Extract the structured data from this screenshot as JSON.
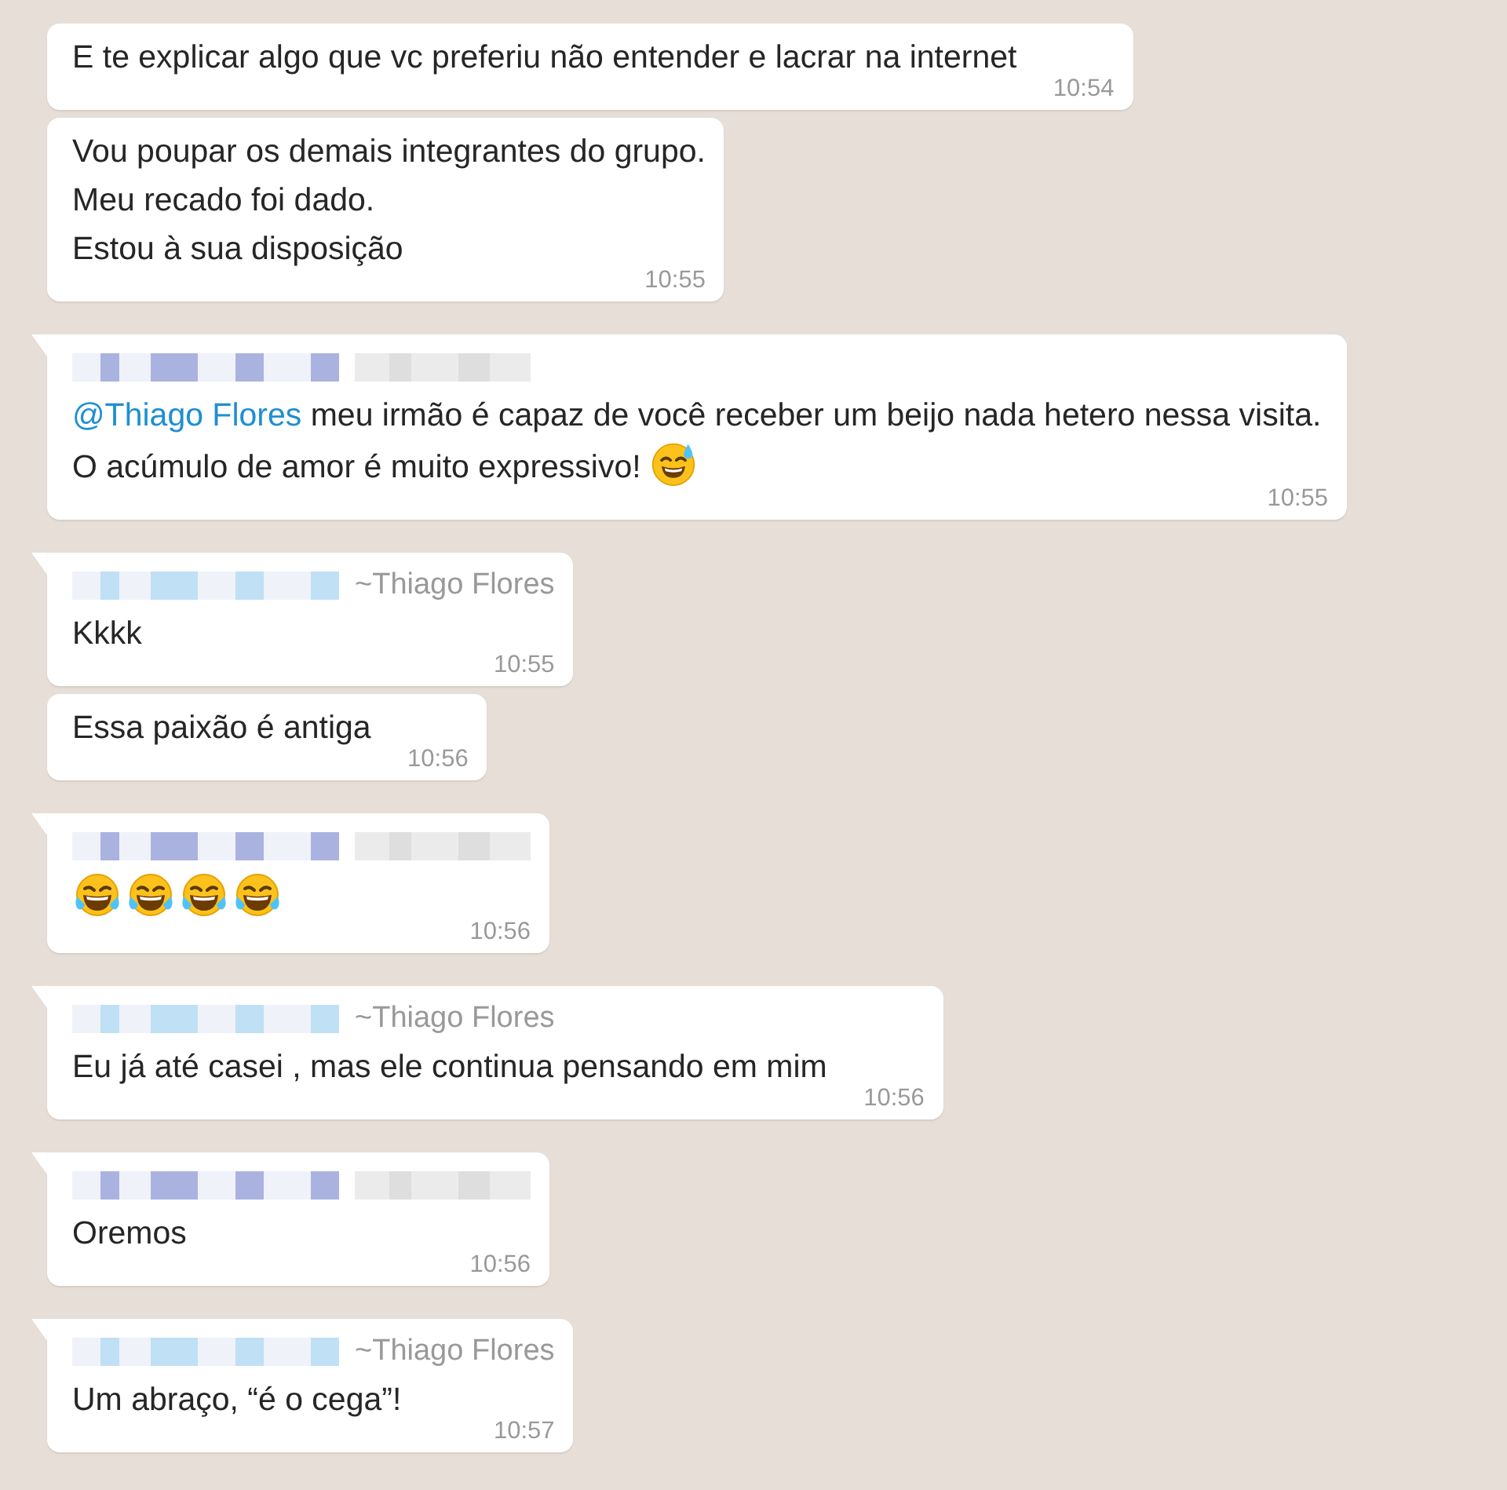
{
  "messages": [
    {
      "tail": false,
      "parts": [
        {
          "kind": "text",
          "text": "E te explicar algo que vc preferiu não entender e lacrar na internet"
        }
      ],
      "time": "10:54"
    },
    {
      "tail": false,
      "parts": [
        {
          "kind": "text",
          "text": "Vou poupar os demais integrantes do grupo.\nMeu recado foi dado.\nEstou à sua disposição"
        }
      ],
      "time": "10:55"
    },
    {
      "tail": true,
      "sender": {
        "color": "#aab3e0"
      },
      "parts": [
        {
          "kind": "mention",
          "text": "@Thiago Flores"
        },
        {
          "kind": "text",
          "text": " meu irmão é capaz de você receber um beijo nada hetero nessa visita. O acúmulo de amor é muito expressivo! "
        },
        {
          "kind": "sweat-smile"
        }
      ],
      "time": "10:55"
    },
    {
      "tail": true,
      "sender": {
        "color": "#bfe0f5",
        "push_name": "~Thiago Flores"
      },
      "parts": [
        {
          "kind": "text",
          "text": "Kkkk"
        }
      ],
      "time": "10:55"
    },
    {
      "tail": false,
      "parts": [
        {
          "kind": "text",
          "text": "Essa paixão é antiga"
        }
      ],
      "time": "10:56"
    },
    {
      "tail": true,
      "sender": {
        "color": "#aab3e0"
      },
      "parts": [
        {
          "kind": "laugh-tears"
        },
        {
          "kind": "laugh-tears"
        },
        {
          "kind": "laugh-tears"
        },
        {
          "kind": "laugh-tears"
        }
      ],
      "time": "10:56"
    },
    {
      "tail": true,
      "sender": {
        "color": "#bfe0f5",
        "push_name": "~Thiago Flores"
      },
      "parts": [
        {
          "kind": "text",
          "text": "Eu já até casei , mas ele continua pensando em mim"
        }
      ],
      "time": "10:56"
    },
    {
      "tail": true,
      "sender": {
        "color": "#aab3e0"
      },
      "parts": [
        {
          "kind": "text",
          "text": "Oremos"
        }
      ],
      "time": "10:56"
    },
    {
      "tail": true,
      "sender": {
        "color": "#bfe0f5",
        "push_name": "~Thiago Flores"
      },
      "parts": [
        {
          "kind": "text",
          "text": "Um abraço, “é o cega”!"
        }
      ],
      "time": "10:57"
    }
  ]
}
